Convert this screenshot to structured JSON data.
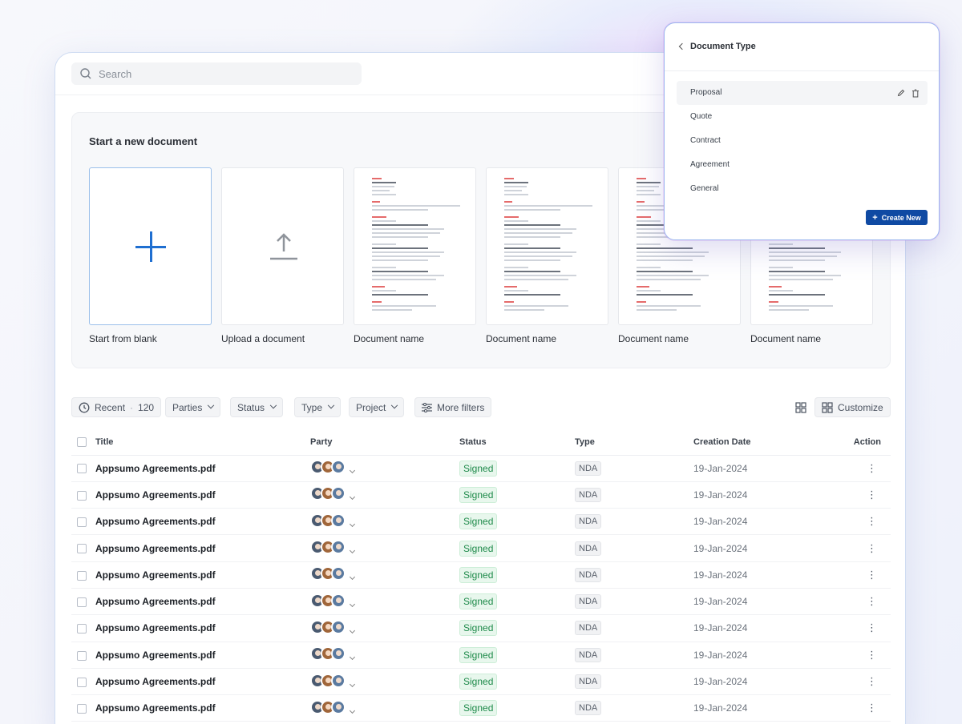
{
  "search": {
    "placeholder": "Search"
  },
  "starter": {
    "title": "Start a new document",
    "cards": [
      {
        "label": "Start from blank"
      },
      {
        "label": "Upload a document"
      },
      {
        "label": "Document name"
      },
      {
        "label": "Document name"
      },
      {
        "label": "Document name"
      },
      {
        "label": "Document name"
      }
    ]
  },
  "filters": {
    "recent": "Recent",
    "recent_count": "120",
    "parties": "Parties",
    "status": "Status",
    "type": "Type",
    "project": "Project",
    "more": "More filters",
    "customize": "Customize"
  },
  "table": {
    "headers": {
      "title": "Title",
      "party": "Party",
      "status": "Status",
      "type": "Type",
      "date": "Creation Date",
      "action": "Action"
    },
    "rows": [
      {
        "title": "Appsumo Agreements.pdf",
        "status": "Signed",
        "type": "NDA",
        "date": "19-Jan-2024"
      },
      {
        "title": "Appsumo Agreements.pdf",
        "status": "Signed",
        "type": "NDA",
        "date": "19-Jan-2024"
      },
      {
        "title": "Appsumo Agreements.pdf",
        "status": "Signed",
        "type": "NDA",
        "date": "19-Jan-2024"
      },
      {
        "title": "Appsumo Agreements.pdf",
        "status": "Signed",
        "type": "NDA",
        "date": "19-Jan-2024"
      },
      {
        "title": "Appsumo Agreements.pdf",
        "status": "Signed",
        "type": "NDA",
        "date": "19-Jan-2024"
      },
      {
        "title": "Appsumo Agreements.pdf",
        "status": "Signed",
        "type": "NDA",
        "date": "19-Jan-2024"
      },
      {
        "title": "Appsumo Agreements.pdf",
        "status": "Signed",
        "type": "NDA",
        "date": "19-Jan-2024"
      },
      {
        "title": "Appsumo Agreements.pdf",
        "status": "Signed",
        "type": "NDA",
        "date": "19-Jan-2024"
      },
      {
        "title": "Appsumo Agreements.pdf",
        "status": "Signed",
        "type": "NDA",
        "date": "19-Jan-2024"
      },
      {
        "title": "Appsumo Agreements.pdf",
        "status": "Signed",
        "type": "NDA",
        "date": "19-Jan-2024"
      }
    ]
  },
  "popup": {
    "title": "Document Type",
    "options": [
      "Proposal",
      "Quote",
      "Contract",
      "Agreement",
      "General"
    ],
    "create_label": "Create New"
  },
  "colors": {
    "accent": "#1f6fd1",
    "primary_button": "#0f4aa3",
    "signed": "#1e8a4a"
  }
}
